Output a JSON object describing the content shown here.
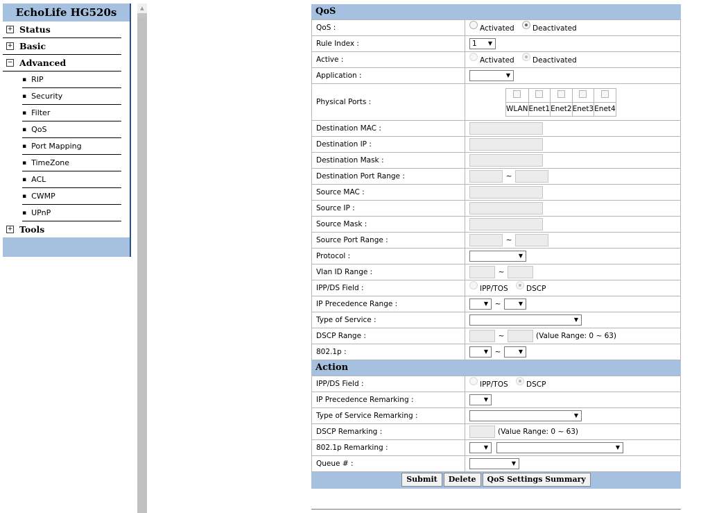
{
  "sidebar": {
    "brand": "EchoLife HG520s",
    "items": [
      {
        "label": "Status",
        "type": "top",
        "expander": "+"
      },
      {
        "label": "Basic",
        "type": "top",
        "expander": "+"
      },
      {
        "label": "Advanced",
        "type": "top",
        "expander": "−"
      },
      {
        "label": "RIP",
        "type": "sub"
      },
      {
        "label": "Security",
        "type": "sub"
      },
      {
        "label": "Filter",
        "type": "sub"
      },
      {
        "label": "QoS",
        "type": "sub"
      },
      {
        "label": "Port Mapping",
        "type": "sub"
      },
      {
        "label": "TimeZone",
        "type": "sub"
      },
      {
        "label": "ACL",
        "type": "sub"
      },
      {
        "label": "CWMP",
        "type": "sub"
      },
      {
        "label": "UPnP",
        "type": "sub"
      },
      {
        "label": "Tools",
        "type": "top",
        "expander": "+"
      }
    ],
    "bullet": "▪"
  },
  "qos_section": {
    "title": "QoS",
    "qos_label": "QoS :",
    "qos_options": [
      "Activated",
      "Deactivated"
    ],
    "qos_selected": "Deactivated",
    "rule_index_label": "Rule Index :",
    "rule_index_value": "1",
    "active_label": "Active :",
    "active_options": [
      "Activated",
      "Deactivated"
    ],
    "active_selected": "Deactivated",
    "application_label": "Application :",
    "application_value": "",
    "physical_ports_label": "Physical Ports :",
    "ports": [
      "WLAN",
      "Enet1",
      "Enet2",
      "Enet3",
      "Enet4"
    ],
    "dest_mac_label": "Destination MAC :",
    "dest_ip_label": "Destination IP :",
    "dest_mask_label": "Destination Mask :",
    "dest_port_range_label": "Destination Port Range :",
    "src_mac_label": "Source MAC :",
    "src_ip_label": "Source IP :",
    "src_mask_label": "Source Mask :",
    "src_port_range_label": "Source Port Range :",
    "protocol_label": "Protocol :",
    "vlan_label": "Vlan ID Range :",
    "ippds_label": "IPP/DS Field :",
    "ippds_options": [
      "IPP/TOS",
      "DSCP"
    ],
    "ippds_selected": "DSCP",
    "ip_prec_label": "IP Precedence Range :",
    "tos_label": "Type of Service :",
    "dscp_range_label": "DSCP Range :",
    "dscp_hint": "(Value Range: 0 ~ 63)",
    "dot1p_label": "802.1p :",
    "tilde": "~"
  },
  "action_section": {
    "title": "Action",
    "ippds_label": "IPP/DS Field :",
    "ippds_options": [
      "IPP/TOS",
      "DSCP"
    ],
    "ippds_selected": "DSCP",
    "ip_prec_label": "IP Precedence Remarking :",
    "tos_label": "Type of Service Remarking :",
    "dscp_label": "DSCP Remarking :",
    "dscp_hint": "(Value Range: 0 ~ 63)",
    "dot1p_label": "802.1p Remarking :",
    "queue_label": "Queue # :"
  },
  "buttons": {
    "submit": "Submit",
    "delete": "Delete",
    "summary": "QoS Settings Summary"
  },
  "icons": {
    "dropdown": "▼",
    "scroll_up": "▲"
  }
}
